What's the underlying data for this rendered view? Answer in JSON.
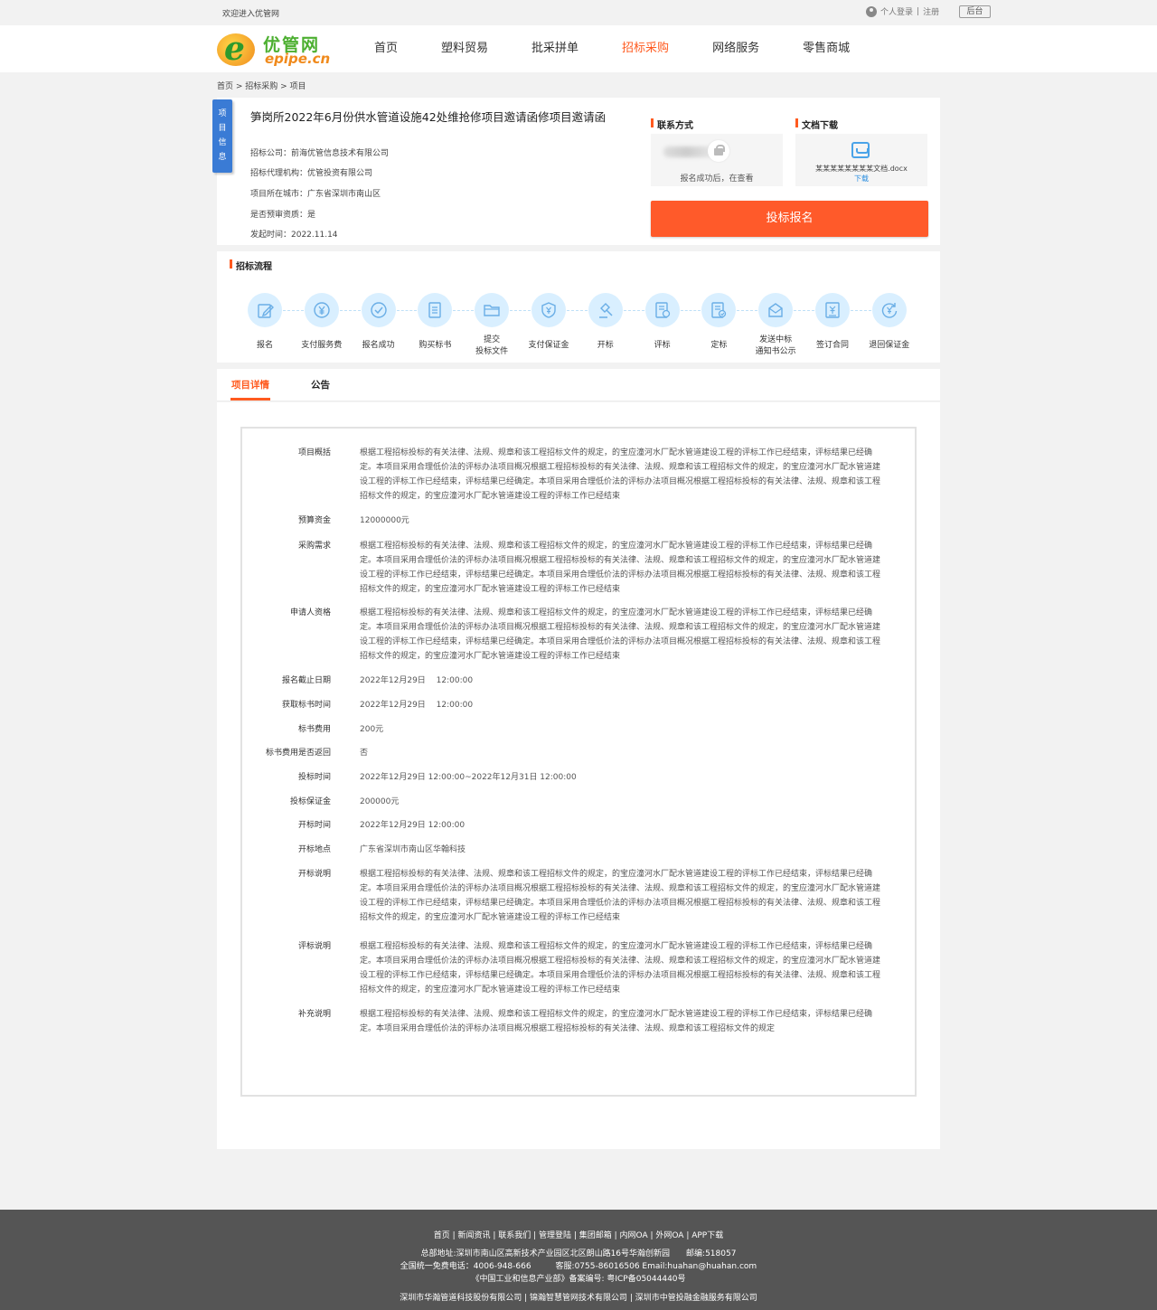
{
  "topbar": {
    "welcome": "欢迎进入优管网",
    "login": "个人登录",
    "sep": "|",
    "register": "注册",
    "backend": "后台"
  },
  "logo": {
    "letter": "e",
    "cn": "优管网",
    "en": "epipe.cn"
  },
  "nav": [
    "首页",
    "塑料贸易",
    "批采拼单",
    "招标采购",
    "网络服务",
    "零售商城"
  ],
  "nav_active": 3,
  "breadcrumb": "首页 > 招标采购 > 项目",
  "project": {
    "tag": "项目信息",
    "title": "笋岗所2022年6月份供水管道设施42处维抢修项目邀请函修项目邀请函",
    "fields": [
      "招标公司：前海优管信息技术有限公司",
      "招标代理机构：优管投资有限公司",
      "项目所在城市：广东省深圳市南山区",
      "是否预审资质：是",
      "发起时间：2022.11.14"
    ]
  },
  "contact": {
    "title": "联系方式",
    "tip": "报名成功后，在查看"
  },
  "document": {
    "title": "文档下载",
    "filename": "某某某某某某某某文档.docx",
    "download": "下载"
  },
  "bid_button": "投标报名",
  "process": {
    "title": "招标流程",
    "steps": [
      {
        "label": "报名",
        "icon": "edit-icon"
      },
      {
        "label": "支付服务费",
        "icon": "yen-icon"
      },
      {
        "label": "报名成功",
        "icon": "check-icon"
      },
      {
        "label": "购买标书",
        "icon": "document-icon"
      },
      {
        "label": "提交\n投标文件",
        "icon": "folder-icon"
      },
      {
        "label": "支付保证金",
        "icon": "shield-yen-icon"
      },
      {
        "label": "开标",
        "icon": "gavel-icon"
      },
      {
        "label": "评标",
        "icon": "review-icon"
      },
      {
        "label": "定标",
        "icon": "stamp-doc-icon"
      },
      {
        "label": "发送中标\n通知书公示",
        "icon": "mail-icon"
      },
      {
        "label": "签订合同",
        "icon": "contract-icon"
      },
      {
        "label": "退回保证金",
        "icon": "refund-icon"
      }
    ]
  },
  "tabs": [
    "项目详情",
    "公告"
  ],
  "details": [
    {
      "k": "项目概括",
      "v": "根据工程招标投标的有关法律、法规、规章和该工程招标文件的规定，的宝应潼河水厂配水管道建设工程的评标工作已经结束，评标结果已经确定。本项目采用合理低价法的评标办法项目概况根据工程招标投标的有关法律、法规、规章和该工程招标文件的规定，的宝应潼河水厂配水管道建设工程的评标工作已经结束，评标结果已经确定。本项目采用合理低价法的评标办法项目概况根据工程招标投标的有关法律、法规、规章和该工程招标文件的规定，的宝应潼河水厂配水管道建设工程的评标工作已经结束"
    },
    {
      "k": "预算资金",
      "v": "12000000元"
    },
    {
      "k": "采购需求",
      "v": "根据工程招标投标的有关法律、法规、规章和该工程招标文件的规定，的宝应潼河水厂配水管道建设工程的评标工作已经结束，评标结果已经确定。本项目采用合理低价法的评标办法项目概况根据工程招标投标的有关法律、法规、规章和该工程招标文件的规定，的宝应潼河水厂配水管道建设工程的评标工作已经结束，评标结果已经确定。本项目采用合理低价法的评标办法项目概况根据工程招标投标的有关法律、法规、规章和该工程招标文件的规定，的宝应潼河水厂配水管道建设工程的评标工作已经结束"
    },
    {
      "k": "申请人资格",
      "v": "根据工程招标投标的有关法律、法规、规章和该工程招标文件的规定，的宝应潼河水厂配水管道建设工程的评标工作已经结束，评标结果已经确定。本项目采用合理低价法的评标办法项目概况根据工程招标投标的有关法律、法规、规章和该工程招标文件的规定，的宝应潼河水厂配水管道建设工程的评标工作已经结束，评标结果已经确定。本项目采用合理低价法的评标办法项目概况根据工程招标投标的有关法律、法规、规章和该工程招标文件的规定，的宝应潼河水厂配水管道建设工程的评标工作已经结束"
    },
    {
      "k": "报名截止日期",
      "v": "2022年12月29日　 12:00:00"
    },
    {
      "k": "获取标书时间",
      "v": "2022年12月29日　 12:00:00"
    },
    {
      "k": "标书费用",
      "v": "200元"
    },
    {
      "k": "标书费用是否返回",
      "v": "否"
    },
    {
      "k": "投标时间",
      "v": "2022年12月29日 12:00:00~2022年12月31日 12:00:00"
    },
    {
      "k": "投标保证金",
      "v": "200000元"
    },
    {
      "k": "开标时间",
      "v": "2022年12月29日 12:00:00"
    },
    {
      "k": "开标地点",
      "v": "广东省深圳市南山区华翰科技"
    },
    {
      "k": "开标说明",
      "v": "根据工程招标投标的有关法律、法规、规章和该工程招标文件的规定，的宝应潼河水厂配水管道建设工程的评标工作已经结束，评标结果已经确定。本项目采用合理低价法的评标办法项目概况根据工程招标投标的有关法律、法规、规章和该工程招标文件的规定，的宝应潼河水厂配水管道建设工程的评标工作已经结束，评标结果已经确定。本项目采用合理低价法的评标办法项目概况根据工程招标投标的有关法律、法规、规章和该工程招标文件的规定，的宝应潼河水厂配水管道建设工程的评标工作已经结束"
    },
    {
      "k": "评标说明",
      "v": "根据工程招标投标的有关法律、法规、规章和该工程招标文件的规定，的宝应潼河水厂配水管道建设工程的评标工作已经结束，评标结果已经确定。本项目采用合理低价法的评标办法项目概况根据工程招标投标的有关法律、法规、规章和该工程招标文件的规定，的宝应潼河水厂配水管道建设工程的评标工作已经结束，评标结果已经确定。本项目采用合理低价法的评标办法项目概况根据工程招标投标的有关法律、法规、规章和该工程招标文件的规定，的宝应潼河水厂配水管道建设工程的评标工作已经结束"
    },
    {
      "k": "补充说明",
      "v": "根据工程招标投标的有关法律、法规、规章和该工程招标文件的规定，的宝应潼河水厂配水管道建设工程的评标工作已经结束，评标结果已经确定。本项目采用合理低价法的评标办法项目概况根据工程招标投标的有关法律、法规、规章和该工程招标文件的规定"
    }
  ],
  "footer": {
    "links": "首页 | 新闻资讯 | 联系我们 | 管理登陆 | 集团邮箱 | 内网OA | 外网OA | APP下载",
    "address": "总部地址:深圳市南山区高新技术产业园区北区朗山路16号华瀚创新园　　邮编:518057",
    "phone": "全国统一免费电话：4006-948-666　　　客服:0755-86016506 Email:huahan@huahan.com",
    "icp": "《中国工业和信息产业部》备案编号: 粤ICP备05044440号",
    "companies": "深圳市华瀚管道科技股份有限公司 | 锦瀚智慧管网技术有限公司 | 深圳市中管投融金融服务有限公司"
  }
}
